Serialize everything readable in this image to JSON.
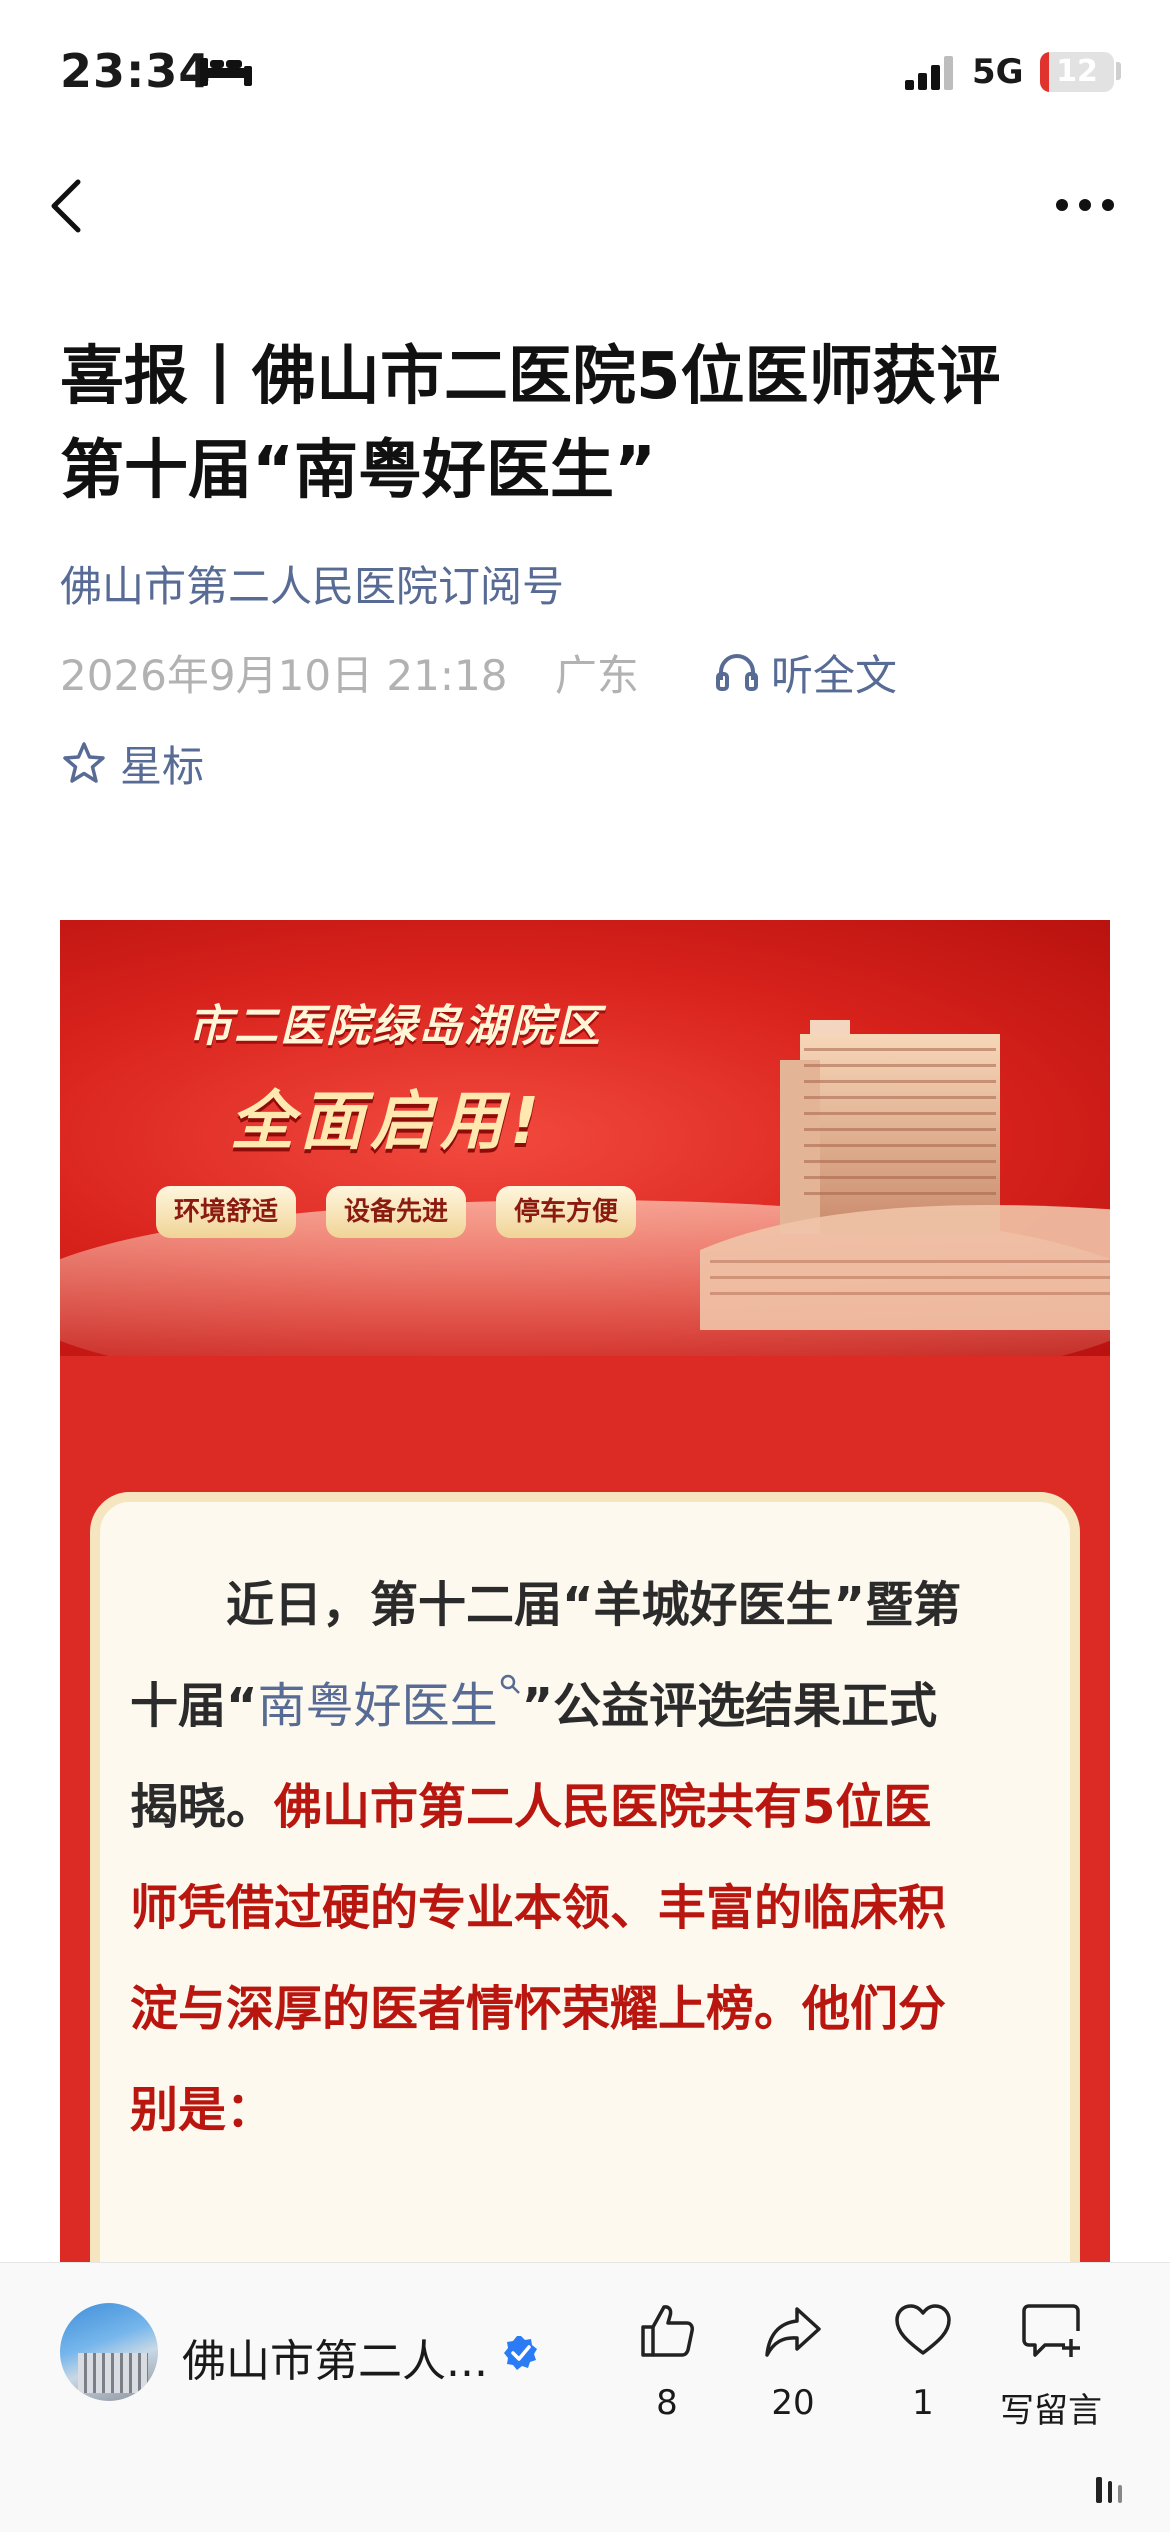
{
  "status_bar": {
    "time": "23:34",
    "network": "5G",
    "battery_level": "12",
    "battery_fraction": 0.12,
    "icons": [
      "bed-icon",
      "signal-icon",
      "battery-icon"
    ]
  },
  "nav": {
    "back_icon": "chevron-left-icon",
    "more_icon": "more-dots-icon"
  },
  "article": {
    "title_line1": "喜报丨佛山市二医院5位医师获评",
    "title_line2": "第十届“南粤好医生”",
    "account": "佛山市第二人民医院订阅号",
    "date": "2026年9月10日 21:18",
    "location": "广东",
    "listen_label": "听全文",
    "star_label": "星标"
  },
  "banner": {
    "line1": "市二医院绿岛湖院区",
    "line2": "全面启用!",
    "tags": [
      "环境舒适",
      "设备先进",
      "停车方便"
    ]
  },
  "body": {
    "seg1": "近日，第十二届“羊城好医生”暨第",
    "seg2_pre": "十届“",
    "seg2_link": "南粤好医生",
    "seg2_post": "”公益评选结果正式",
    "seg3_plain": "揭晓。",
    "seg3_red": "佛山市第二人民医院共有5位医",
    "seg4_red": "师凭借过硬的专业本领、丰富的临床积",
    "seg5_red": "淀与深厚的医者情怀荣耀上榜。他们分",
    "seg6_red": "别是："
  },
  "toolbar": {
    "author": "佛山市第二人...",
    "like_count": "8",
    "share_count": "20",
    "favorite_count": "1",
    "comment_label": "写留言"
  },
  "colors": {
    "link_blue": "#576b95",
    "meta_gray": "#b2b2b2",
    "banner_red": "#dc2a24",
    "highlight_red": "#b8160f",
    "card_bg": "#fdf9ef"
  }
}
